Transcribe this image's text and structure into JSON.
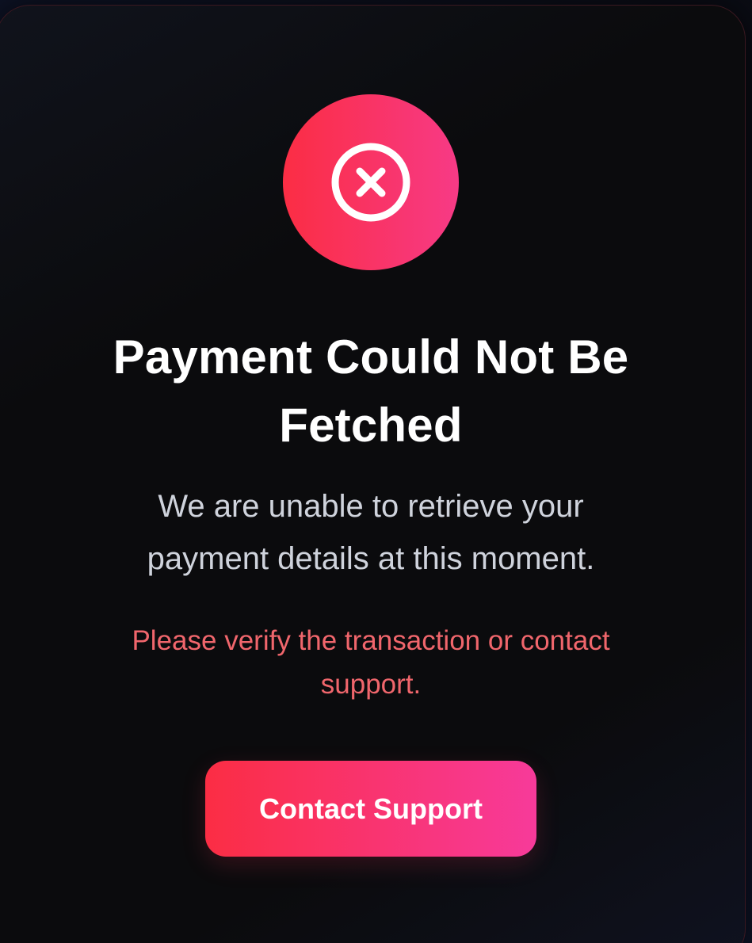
{
  "error_icon": {
    "name": "circle-x-icon",
    "gradient_start": "#fb2d44",
    "gradient_end": "#f73a86"
  },
  "title": "Payment Could Not Be Fetched",
  "message": "We are unable to retrieve your payment details at this moment.",
  "hint": "Please verify the transaction or contact support.",
  "action": {
    "label": "Contact Support"
  },
  "colors": {
    "background": "#0b0b0d",
    "title": "#ffffff",
    "message": "#cfd3dc",
    "hint": "#f0666c",
    "accent": "#fb2d44"
  }
}
